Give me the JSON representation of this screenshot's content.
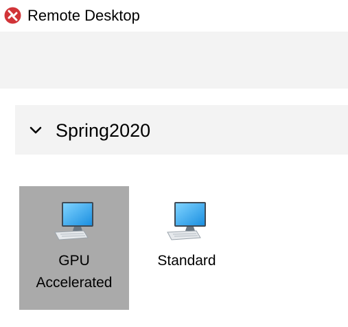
{
  "window": {
    "title": "Remote Desktop",
    "logo_icon": "remote-desktop-logo-icon"
  },
  "group": {
    "name": "Spring2020",
    "expanded": true,
    "chevron_icon": "chevron-down-icon"
  },
  "resources": [
    {
      "label": "GPU Accelerated",
      "icon": "desktop-computer-icon",
      "selected": true
    },
    {
      "label": "Standard",
      "icon": "desktop-computer-icon",
      "selected": false
    }
  ],
  "colors": {
    "band_background": "#f3f3f3",
    "selected_tile": "#aaaaaa",
    "logo_red": "#d13438",
    "monitor_blue": "#2b9ee6"
  }
}
